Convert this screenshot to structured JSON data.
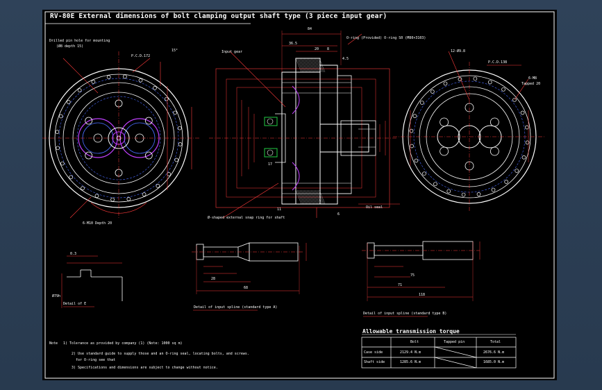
{
  "drawing": {
    "title": "RV-80E  External dimensions of bolt clamping output shaft type (3 piece input gear)",
    "colors": {
      "background": "#000000",
      "outline": "#ffffff",
      "dimension": "#ff2020",
      "hidden": "#4a6bff",
      "part": "#c040ff",
      "seal": "#22cc44",
      "frame": "#ffffff"
    }
  },
  "labels": {
    "pin_hole": "Drilled pin hole for mounting",
    "pin_hole_sub": "(Ø8 depth 15)",
    "pcd_left": "P.C.D.172",
    "angle_left": "15°",
    "tap_left": "6-M10 Depth 20",
    "input_gear": "Input gear",
    "oring": "O-ring (Provided) O-ring S0 (M80×3103)",
    "shaft_seal": "Oil seal",
    "input_spline_note": "Ø-shaped external snap ring for shaft",
    "dim_84": "84",
    "dim_36": "36.5",
    "dim_20": "20",
    "dim_8": "8",
    "dim_41": "4.5",
    "dim_17": "17",
    "dim_11": "11",
    "dim_6": "6",
    "holes_right": "12-Ø9.8",
    "pcd_right": "P.C.D.138",
    "tap_right": "6-M8",
    "tap_right_sub": "Tapped 20",
    "detail_a": "Detail of E",
    "detail_a_dim": "0.3",
    "detail_a_dia": "Ø79h",
    "spline_std": "Detail of input spline (standard type A)",
    "spline_opt": "Detail of input spline (standard type B)",
    "dim_28": "28",
    "dim_68": "68",
    "dim_71": "71",
    "dim_118": "118",
    "dim_75": "75"
  },
  "notes": {
    "n1_label": "Note",
    "n1": "1) Tolerance as provided by company (1) (Note: 1000 sq m)",
    "n2": "2) Use standard guide to supply those and an O-ring seal, locating bolts, and screws.",
    "n2b": "for O-ring see that",
    "n3": "3) Specifications and dimensions are subject to change without notice."
  },
  "table": {
    "title": "Allowable  transmission  torque",
    "headers": [
      "",
      "Bolt",
      "Tapped pin",
      "Total"
    ],
    "rows": [
      [
        "Case side",
        "2129.4 N.m",
        "",
        "2676.6 N.m"
      ],
      [
        "Shaft side",
        "1285.6 N.m",
        "",
        "1685.0 N.m"
      ]
    ]
  }
}
